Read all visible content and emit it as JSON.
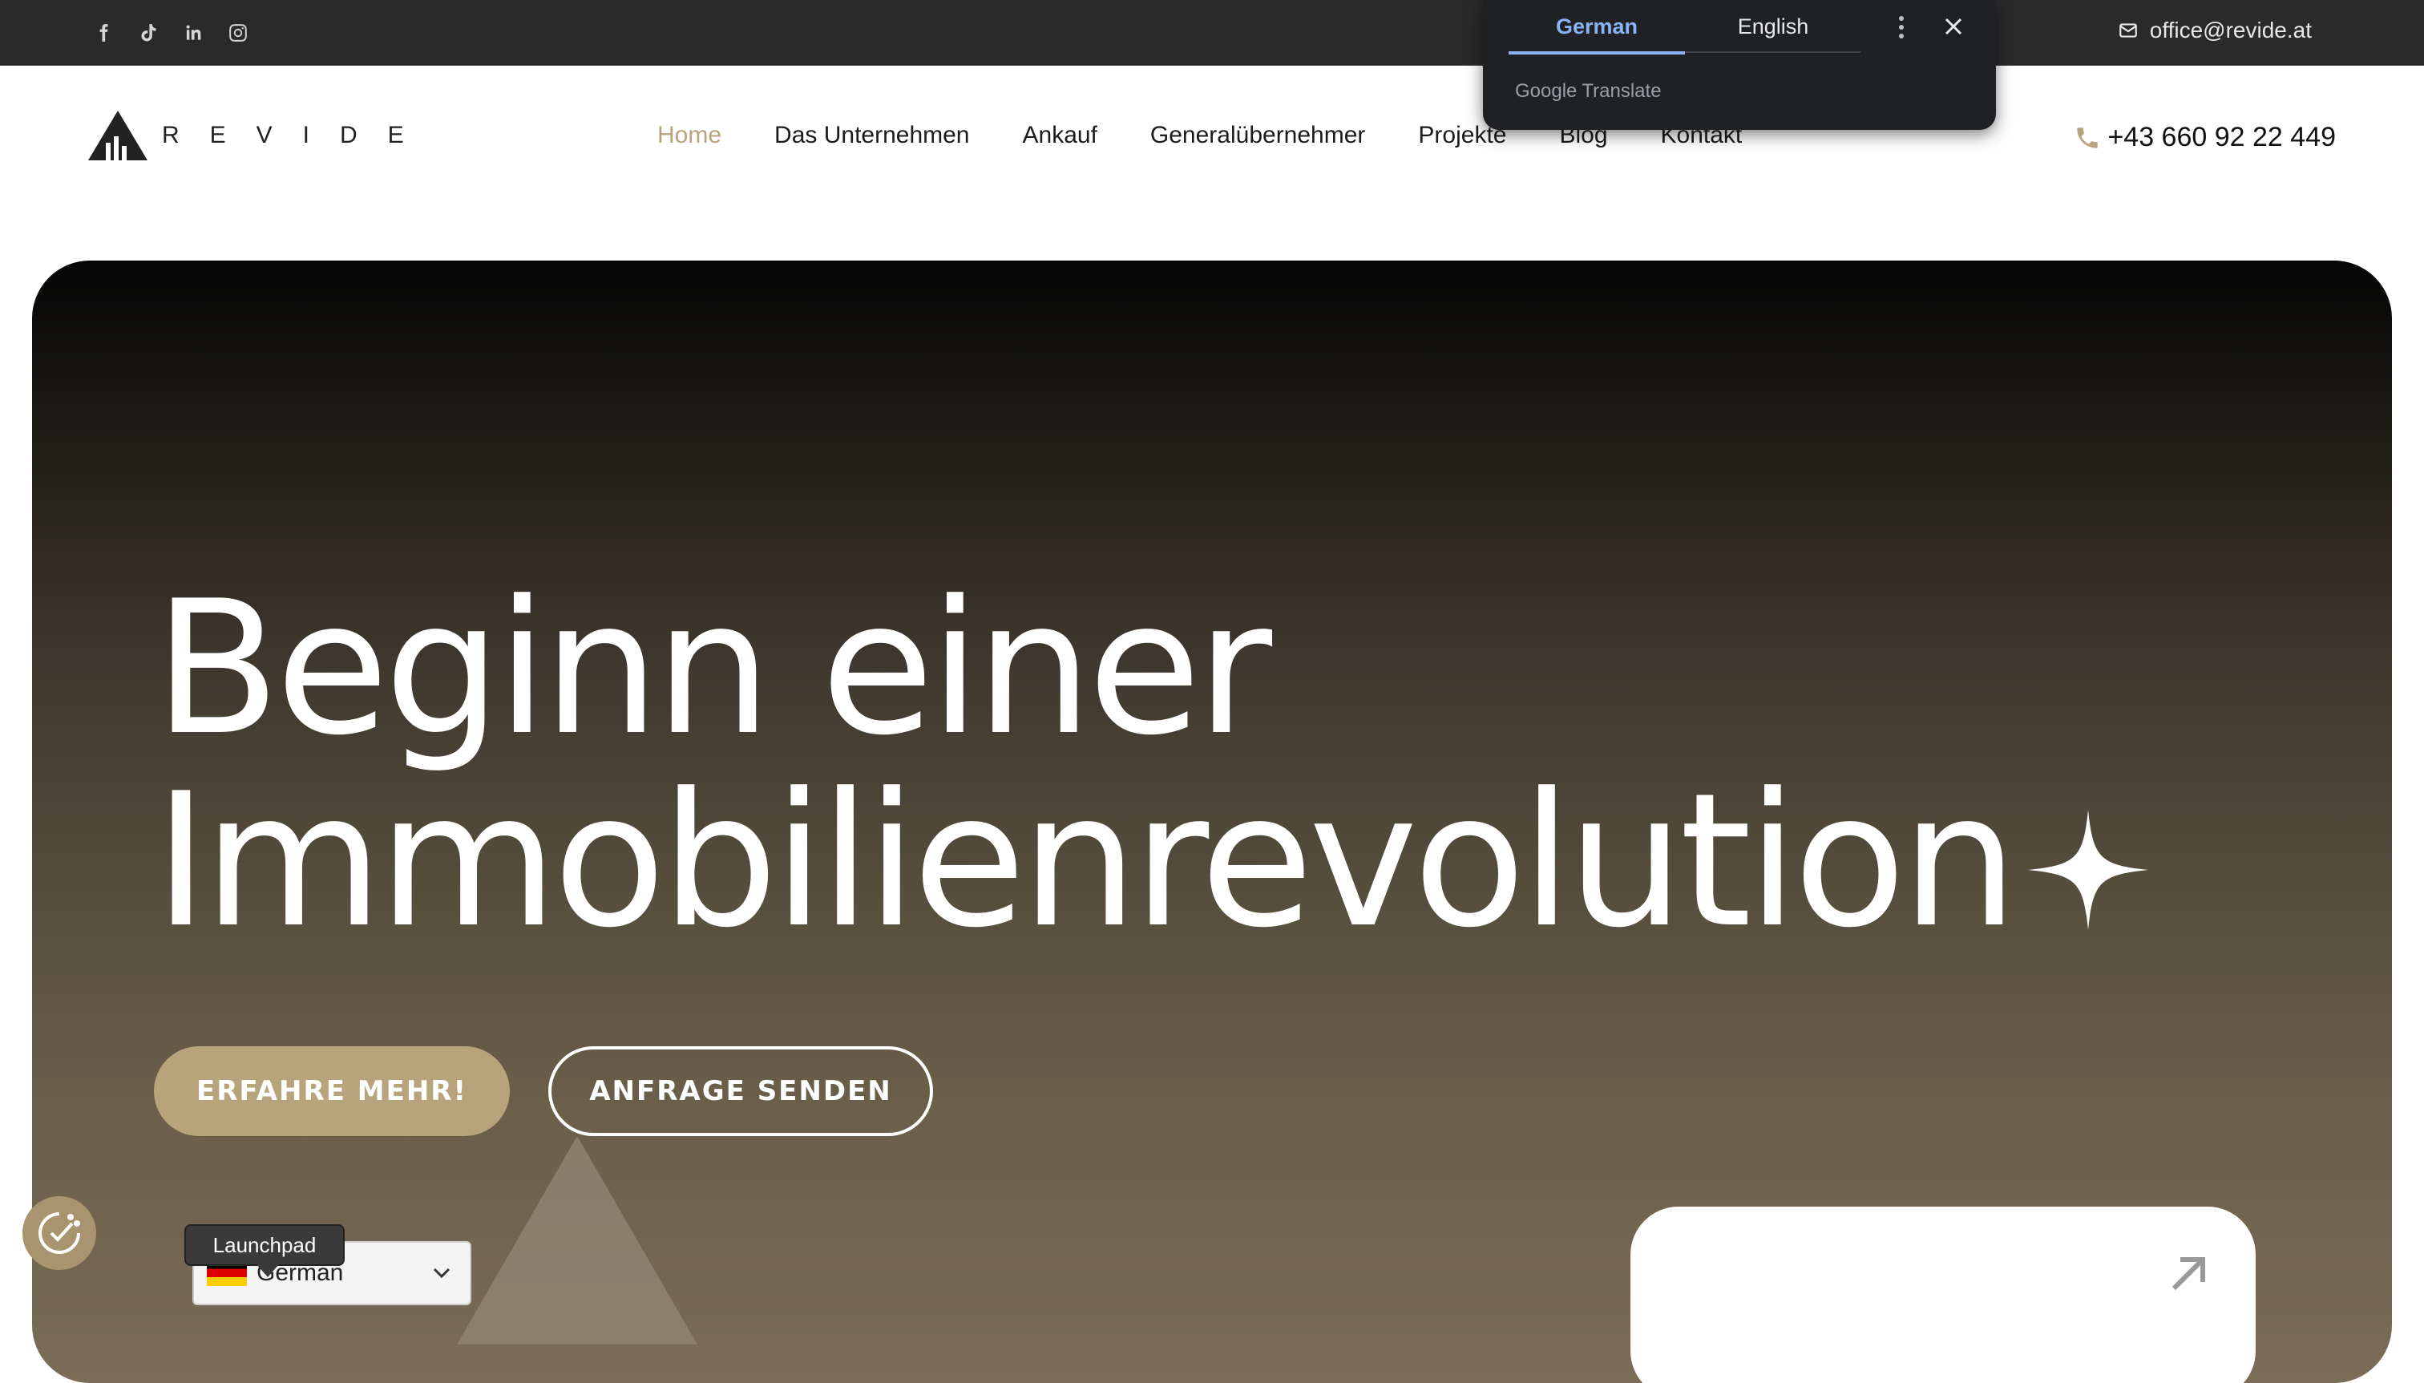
{
  "topbar": {
    "social": [
      "facebook-icon",
      "tiktok-icon",
      "linkedin-icon",
      "instagram-icon"
    ],
    "email": "office@revide.at"
  },
  "nav": {
    "logo_text": "REVIDE",
    "items": [
      {
        "label": "Home",
        "active": true
      },
      {
        "label": "Das Unternehmen",
        "active": false
      },
      {
        "label": "Ankauf",
        "active": false
      },
      {
        "label": "Generalübernehmer",
        "active": false
      },
      {
        "label": "Projekte",
        "active": false
      },
      {
        "label": "Blog",
        "active": false
      },
      {
        "label": "Kontakt",
        "active": false
      }
    ],
    "phone": "+43 660 92 22 449"
  },
  "hero": {
    "headline_line1": "Beginn einer",
    "headline_line2": "Immobilienrevolution",
    "primary_cta": "ERFAHRE MEHR!",
    "secondary_cta": "ANFRAGE SENDEN"
  },
  "widgets": {
    "tooltip": "Launchpad",
    "language_select_value": "German"
  },
  "translate_popup": {
    "tabs": [
      "German",
      "English"
    ],
    "active_tab": "German",
    "brand_google": "Google",
    "brand_translate": "Translate"
  },
  "colors": {
    "accent": "#b9a47d",
    "topbar_bg": "#2a2a2a",
    "translate_active": "#8ab4f8"
  }
}
